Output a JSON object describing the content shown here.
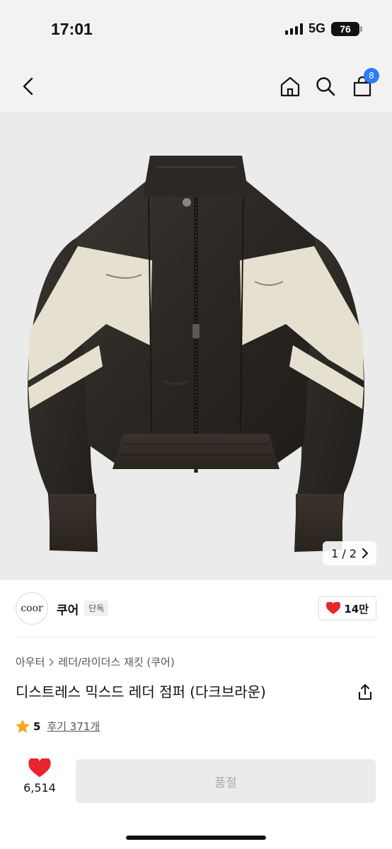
{
  "status": {
    "time": "17:01",
    "network": "5G",
    "battery": "76"
  },
  "nav": {
    "back_icon": "chevron-left-icon",
    "home_icon": "home-icon",
    "search_icon": "search-icon",
    "cart_icon": "shopping-bag-icon",
    "cart_count": "8"
  },
  "gallery": {
    "counter": "1 / 2",
    "current": 1,
    "total": 2
  },
  "brand": {
    "logo_text": "coor",
    "name": "쿠어",
    "tag": "단독",
    "like_count": "14만"
  },
  "breadcrumb": {
    "category": "아우터",
    "subcategory": "레더/라이더스 재킷 (쿠어)"
  },
  "product": {
    "title": "디스트레스 믹스드 레더 점퍼 (다크브라운)"
  },
  "rating": {
    "score": "5",
    "review_label": "후기 371개"
  },
  "actions": {
    "wish_count": "6,514",
    "primary_label": "품절"
  },
  "colors": {
    "accent_blue": "#2f7cf6",
    "heart_red": "#e8242f",
    "star_orange": "#f5a623",
    "disabled_bg": "#ebebeb"
  }
}
